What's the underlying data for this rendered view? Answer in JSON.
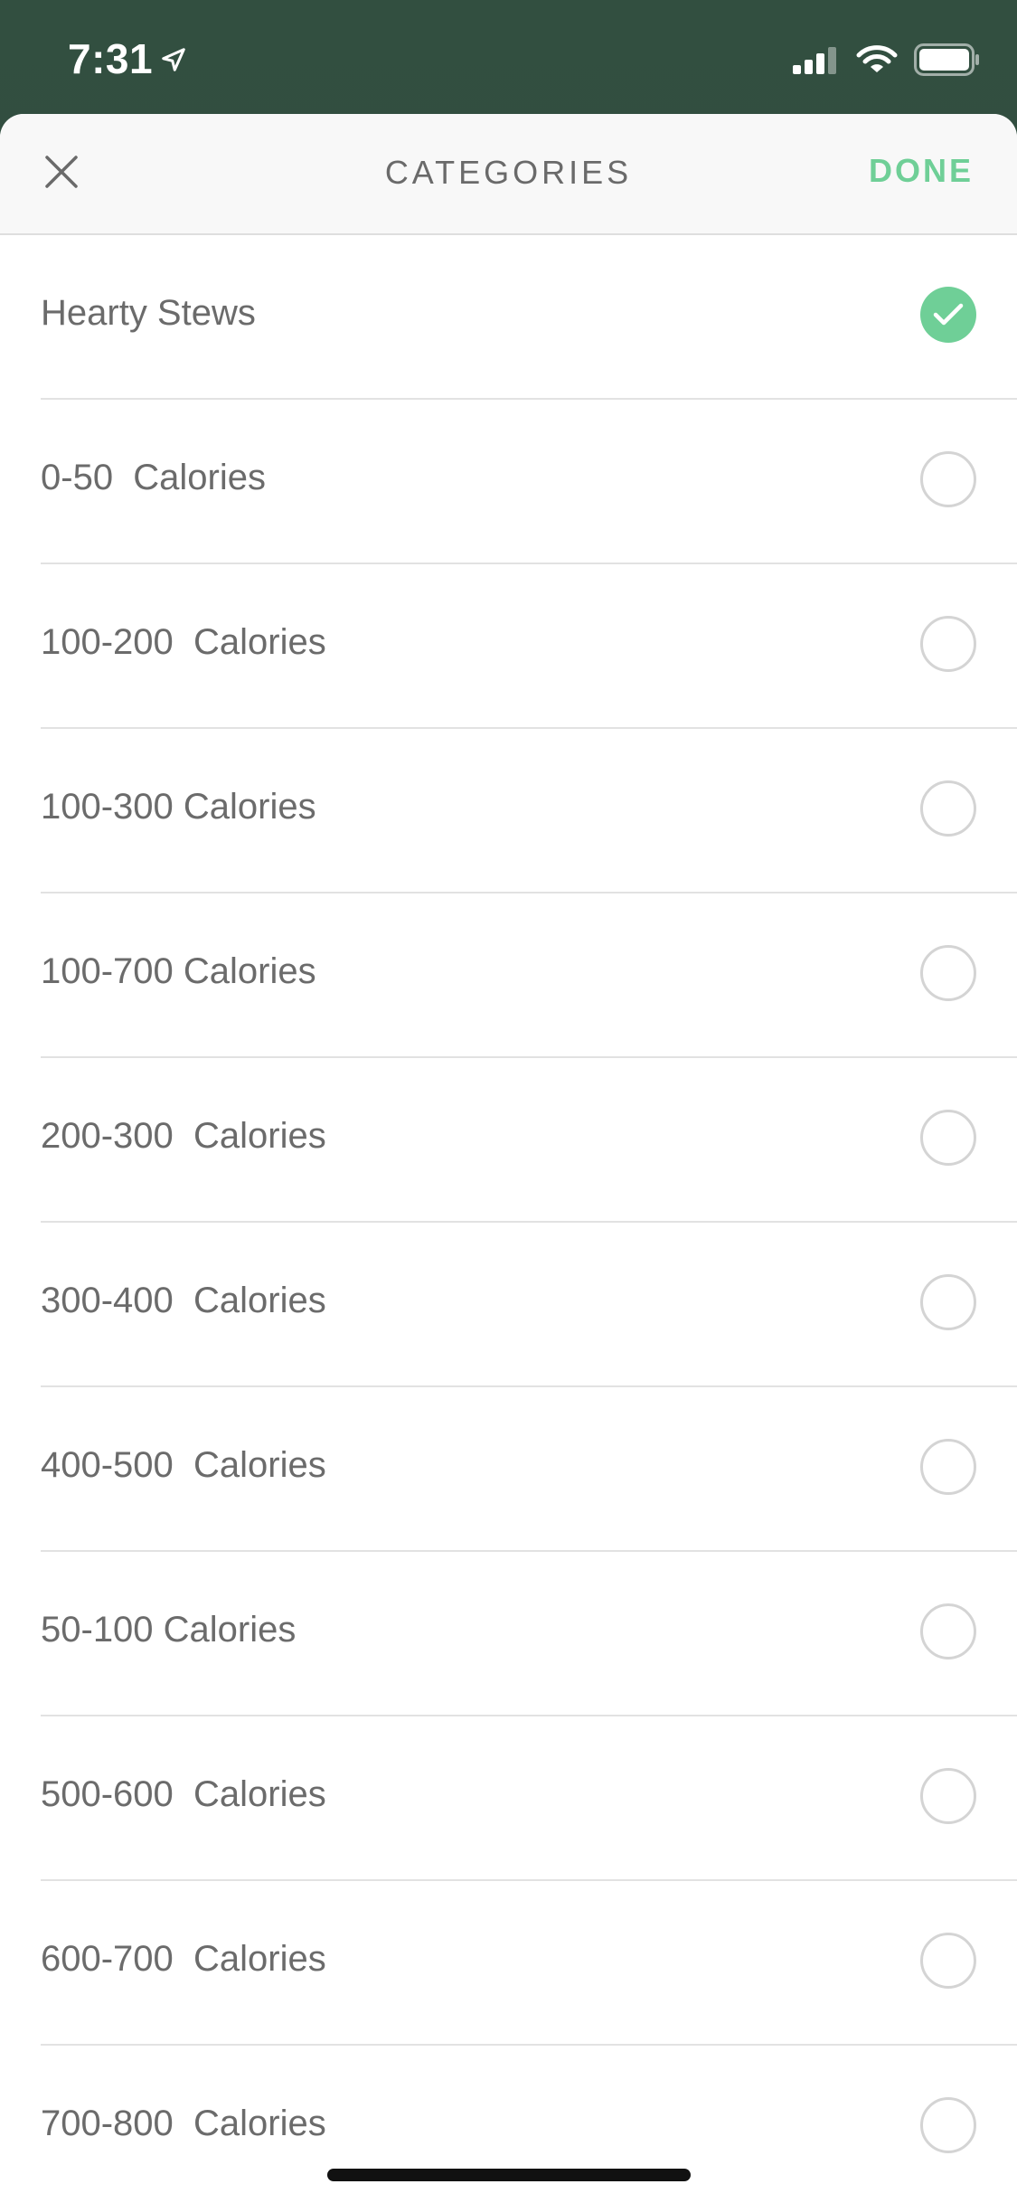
{
  "status_bar": {
    "time": "7:31",
    "icons": [
      "location-arrow-icon",
      "cellular-signal-icon",
      "wifi-icon",
      "battery-icon"
    ]
  },
  "header": {
    "title": "CATEGORIES",
    "close_icon": "close-icon",
    "done_label": "DONE"
  },
  "colors": {
    "accent": "#6fcf97",
    "status_bar_bg": "#2e4a3b",
    "text": "#6b6b6b"
  },
  "categories": [
    {
      "label": "Hearty Stews",
      "selected": true
    },
    {
      "label": "0-50  Calories",
      "selected": false
    },
    {
      "label": "100-200  Calories",
      "selected": false
    },
    {
      "label": "100-300 Calories",
      "selected": false
    },
    {
      "label": "100-700 Calories",
      "selected": false
    },
    {
      "label": "200-300  Calories",
      "selected": false
    },
    {
      "label": "300-400  Calories",
      "selected": false
    },
    {
      "label": "400-500  Calories",
      "selected": false
    },
    {
      "label": "50-100 Calories",
      "selected": false
    },
    {
      "label": "500-600  Calories",
      "selected": false
    },
    {
      "label": "600-700  Calories",
      "selected": false
    },
    {
      "label": "700-800  Calories",
      "selected": false
    }
  ]
}
